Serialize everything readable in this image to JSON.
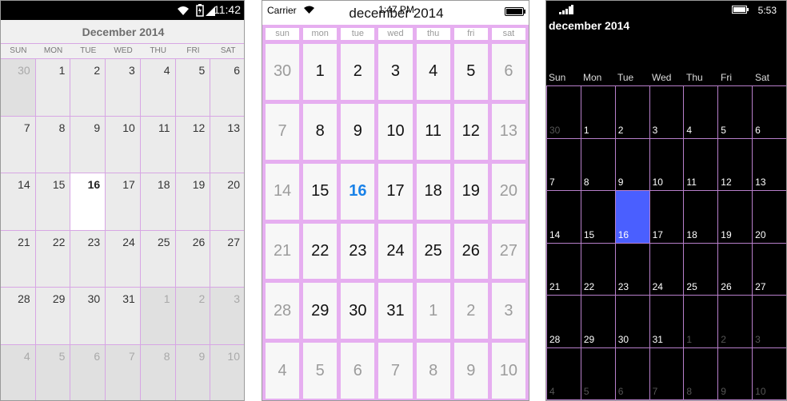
{
  "android": {
    "time": "11:42",
    "title": "December 2014",
    "days_of_week": [
      "SUN",
      "MON",
      "TUE",
      "WED",
      "THU",
      "FRI",
      "SAT"
    ],
    "cells": [
      {
        "d": "30",
        "o": true
      },
      {
        "d": "1"
      },
      {
        "d": "2"
      },
      {
        "d": "3"
      },
      {
        "d": "4"
      },
      {
        "d": "5"
      },
      {
        "d": "6"
      },
      {
        "d": "7"
      },
      {
        "d": "8"
      },
      {
        "d": "9"
      },
      {
        "d": "10"
      },
      {
        "d": "11"
      },
      {
        "d": "12"
      },
      {
        "d": "13"
      },
      {
        "d": "14"
      },
      {
        "d": "15"
      },
      {
        "d": "16",
        "s": true
      },
      {
        "d": "17"
      },
      {
        "d": "18"
      },
      {
        "d": "19"
      },
      {
        "d": "20"
      },
      {
        "d": "21"
      },
      {
        "d": "22"
      },
      {
        "d": "23"
      },
      {
        "d": "24"
      },
      {
        "d": "25"
      },
      {
        "d": "26"
      },
      {
        "d": "27"
      },
      {
        "d": "28"
      },
      {
        "d": "29"
      },
      {
        "d": "30"
      },
      {
        "d": "31"
      },
      {
        "d": "1",
        "o": true
      },
      {
        "d": "2",
        "o": true
      },
      {
        "d": "3",
        "o": true
      },
      {
        "d": "4",
        "o": true
      },
      {
        "d": "5",
        "o": true
      },
      {
        "d": "6",
        "o": true
      },
      {
        "d": "7",
        "o": true
      },
      {
        "d": "8",
        "o": true
      },
      {
        "d": "9",
        "o": true
      },
      {
        "d": "10",
        "o": true
      }
    ]
  },
  "ios": {
    "carrier": "Carrier",
    "time": "1:47 PM",
    "title": "december 2014",
    "days_of_week": [
      "sun",
      "mon",
      "tue",
      "wed",
      "thu",
      "fri",
      "sat"
    ],
    "cells": [
      {
        "d": "30",
        "o": true
      },
      {
        "d": "1"
      },
      {
        "d": "2"
      },
      {
        "d": "3"
      },
      {
        "d": "4"
      },
      {
        "d": "5"
      },
      {
        "d": "6",
        "o": true
      },
      {
        "d": "7",
        "o": true
      },
      {
        "d": "8"
      },
      {
        "d": "9"
      },
      {
        "d": "10"
      },
      {
        "d": "11"
      },
      {
        "d": "12"
      },
      {
        "d": "13",
        "o": true
      },
      {
        "d": "14",
        "o": true
      },
      {
        "d": "15"
      },
      {
        "d": "16",
        "s": true
      },
      {
        "d": "17"
      },
      {
        "d": "18"
      },
      {
        "d": "19"
      },
      {
        "d": "20",
        "o": true
      },
      {
        "d": "21",
        "o": true
      },
      {
        "d": "22"
      },
      {
        "d": "23"
      },
      {
        "d": "24"
      },
      {
        "d": "25"
      },
      {
        "d": "26"
      },
      {
        "d": "27",
        "o": true
      },
      {
        "d": "28",
        "o": true
      },
      {
        "d": "29"
      },
      {
        "d": "30"
      },
      {
        "d": "31"
      },
      {
        "d": "1",
        "o": true
      },
      {
        "d": "2",
        "o": true
      },
      {
        "d": "3",
        "o": true
      },
      {
        "d": "4",
        "o": true
      },
      {
        "d": "5",
        "o": true
      },
      {
        "d": "6",
        "o": true
      },
      {
        "d": "7",
        "o": true
      },
      {
        "d": "8",
        "o": true
      },
      {
        "d": "9",
        "o": true
      },
      {
        "d": "10",
        "o": true
      }
    ]
  },
  "wp": {
    "time": "5:53",
    "title": "december 2014",
    "days_of_week": [
      "Sun",
      "Mon",
      "Tue",
      "Wed",
      "Thu",
      "Fri",
      "Sat"
    ],
    "cells": [
      {
        "d": "30",
        "o": true
      },
      {
        "d": "1"
      },
      {
        "d": "2"
      },
      {
        "d": "3"
      },
      {
        "d": "4"
      },
      {
        "d": "5"
      },
      {
        "d": "6"
      },
      {
        "d": "7"
      },
      {
        "d": "8"
      },
      {
        "d": "9"
      },
      {
        "d": "10"
      },
      {
        "d": "11"
      },
      {
        "d": "12"
      },
      {
        "d": "13"
      },
      {
        "d": "14"
      },
      {
        "d": "15"
      },
      {
        "d": "16",
        "s": true
      },
      {
        "d": "17"
      },
      {
        "d": "18"
      },
      {
        "d": "19"
      },
      {
        "d": "20"
      },
      {
        "d": "21"
      },
      {
        "d": "22"
      },
      {
        "d": "23"
      },
      {
        "d": "24"
      },
      {
        "d": "25"
      },
      {
        "d": "26"
      },
      {
        "d": "27"
      },
      {
        "d": "28"
      },
      {
        "d": "29"
      },
      {
        "d": "30"
      },
      {
        "d": "31"
      },
      {
        "d": "1",
        "o": true
      },
      {
        "d": "2",
        "o": true
      },
      {
        "d": "3",
        "o": true
      },
      {
        "d": "4",
        "o": true
      },
      {
        "d": "5",
        "o": true
      },
      {
        "d": "6",
        "o": true
      },
      {
        "d": "7",
        "o": true
      },
      {
        "d": "8",
        "o": true
      },
      {
        "d": "9",
        "o": true
      },
      {
        "d": "10",
        "o": true
      }
    ]
  },
  "colors": {
    "grid_line": "#d7a6e4",
    "ios_selected": "#1a82e8",
    "wp_selected": "#4a5fff"
  },
  "icons": [
    "wifi-icon",
    "battery-icon",
    "signal-icon"
  ]
}
